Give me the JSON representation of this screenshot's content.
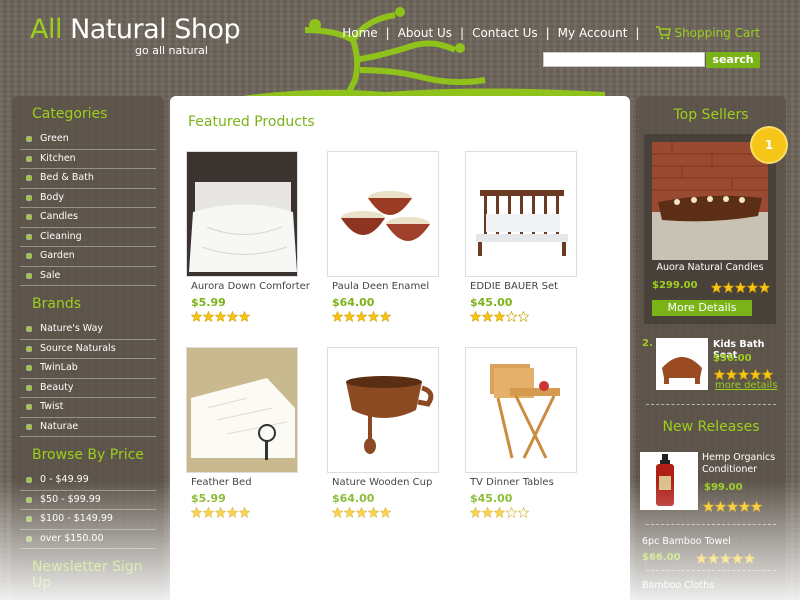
{
  "header": {
    "brand_all": "All",
    "brand_rest": " Natural Shop",
    "tagline": "go all natural",
    "nav": [
      "Home",
      "About Us",
      "Contact Us",
      "My Account"
    ],
    "cart_label": "Shopping Cart",
    "search_button": "search",
    "search_value": ""
  },
  "left_sidebar": {
    "categories_title": "Categories",
    "categories": [
      "Green",
      "Kitchen",
      "Bed & Bath",
      "Body",
      "Candles",
      "Cleaning",
      "Garden",
      "Sale"
    ],
    "brands_title": "Brands",
    "brands": [
      "Nature's Way",
      "Source Naturals",
      "TwinLab",
      "Beauty",
      "Twist",
      "Naturae"
    ],
    "price_title": "Browse By Price",
    "prices": [
      "0 - $49.99",
      "$50 - $99.99",
      "$100 - $149.99",
      "over $150.00"
    ],
    "newsletter_title": "Newsletter Sign Up"
  },
  "main": {
    "title": "Featured Products",
    "products": [
      {
        "name": "Aurora Down Comforter",
        "price": "$5.99",
        "rating": 5
      },
      {
        "name": "Paula Deen Enamel",
        "price": "$64.00",
        "rating": 5
      },
      {
        "name": "EDDIE BAUER Set",
        "price": "$45.00",
        "rating": 3
      },
      {
        "name": "Feather Bed",
        "price": "$5.99",
        "rating": 5
      },
      {
        "name": "Nature Wooden Cup",
        "price": "$64.00",
        "rating": 5
      },
      {
        "name": "TV Dinner Tables",
        "price": "$45.00",
        "rating": 3
      }
    ]
  },
  "right_sidebar": {
    "top_sellers_title": "Top Sellers",
    "badge": "1",
    "top1_name": "Auora Natural Candles",
    "top1_price": "$299.00",
    "top1_rating": 5,
    "more_details_button": "More Details",
    "top2_rank": "2.",
    "top2_name": "Kids Bath Seat",
    "top2_price": "$56.00",
    "top2_rating": 5,
    "top2_link": "more details",
    "new_releases_title": "New Releases",
    "nr1_name_line1": "Hemp Organics",
    "nr1_name_line2": "Conditioner",
    "nr1_price": "$99.00",
    "nr1_rating": 5,
    "nr2_name": "6pc Bamboo Towel",
    "nr2_price": "$66.00",
    "nr2_rating": 5,
    "nr3_name": "Bamboo Cloths"
  },
  "colors": {
    "accent_green": "#7ab317",
    "title_green": "#9ccf1c",
    "star_gold": "#f5c518",
    "panel_brown": "#584e46"
  }
}
